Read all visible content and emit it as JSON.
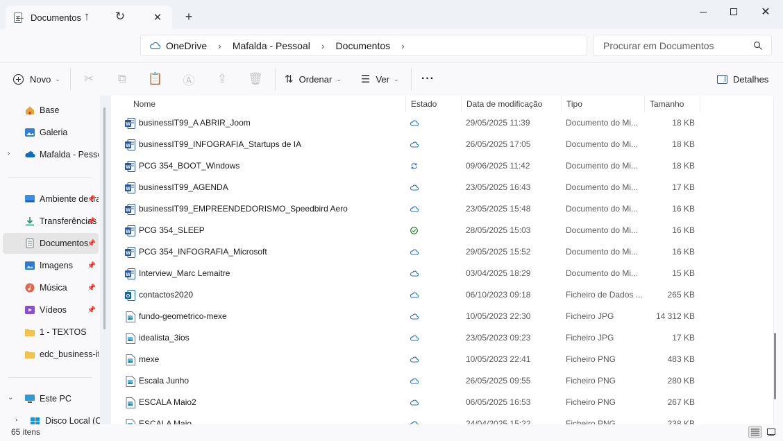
{
  "window": {
    "tab_title": "Documentos",
    "new_tab": "+",
    "close_tab": "✕"
  },
  "breadcrumb": {
    "items": [
      "OneDrive",
      "Mafalda - Pessoal",
      "Documentos"
    ]
  },
  "search": {
    "placeholder": "Procurar em Documentos"
  },
  "toolbar": {
    "new_label": "Novo",
    "sort_label": "Ordenar",
    "view_label": "Ver",
    "more_label": "···",
    "details_label": "Detalhes"
  },
  "sidebar": {
    "items": [
      {
        "label": "Base",
        "icon": "home-icon"
      },
      {
        "label": "Galeria",
        "icon": "gallery-icon"
      },
      {
        "label": "Mafalda - Pessoal",
        "icon": "onedrive-icon"
      },
      {
        "label": "Ambiente de trabalho",
        "icon": "desktop-icon"
      },
      {
        "label": "Transferências",
        "icon": "download-icon"
      },
      {
        "label": "Documentos",
        "icon": "documents-icon"
      },
      {
        "label": "Imagens",
        "icon": "pictures-icon"
      },
      {
        "label": "Música",
        "icon": "music-icon"
      },
      {
        "label": "Vídeos",
        "icon": "videos-icon"
      },
      {
        "label": "1 - TEXTOS",
        "icon": "folder-icon"
      },
      {
        "label": "edc_business-it-",
        "icon": "folder-icon"
      },
      {
        "label": "Este PC",
        "icon": "pc-icon"
      },
      {
        "label": "Disco Local (C:)",
        "icon": "drive-icon"
      }
    ]
  },
  "columns": {
    "name": "Nome",
    "state": "Estado",
    "date": "Data de modificação",
    "type": "Tipo",
    "size": "Tamanho"
  },
  "files": [
    {
      "name": "businessIT99_A ABRIR_Joom",
      "state": "cloud",
      "date": "29/05/2025 11:39",
      "type": "Documento do Mi...",
      "size": "18 KB",
      "icon": "word"
    },
    {
      "name": "businessIT99_INFOGRAFIA_Startups de IA",
      "state": "cloud",
      "date": "26/05/2025 17:05",
      "type": "Documento do Mi...",
      "size": "18 KB",
      "icon": "word"
    },
    {
      "name": "PCG 354_BOOT_Windows",
      "state": "sync",
      "date": "09/06/2025 11:42",
      "type": "Documento do Mi...",
      "size": "18 KB",
      "icon": "word"
    },
    {
      "name": "businessIT99_AGENDA",
      "state": "cloud",
      "date": "23/05/2025 16:43",
      "type": "Documento do Mi...",
      "size": "17 KB",
      "icon": "word"
    },
    {
      "name": "businessIT99_EMPREENDEDORISMO_Speedbird Aero",
      "state": "cloud",
      "date": "23/05/2025 15:48",
      "type": "Documento do Mi...",
      "size": "16 KB",
      "icon": "word"
    },
    {
      "name": "PCG 354_SLEEP",
      "state": "available",
      "date": "28/05/2025 15:03",
      "type": "Documento do Mi...",
      "size": "16 KB",
      "icon": "word"
    },
    {
      "name": "PCG 354_INFOGRAFIA_Microsoft",
      "state": "cloud",
      "date": "29/05/2025 15:52",
      "type": "Documento do Mi...",
      "size": "16 KB",
      "icon": "word"
    },
    {
      "name": "Interview_Marc Lemaitre",
      "state": "cloud",
      "date": "03/04/2025 18:29",
      "type": "Documento do Mi...",
      "size": "15 KB",
      "icon": "word"
    },
    {
      "name": "contactos2020",
      "state": "cloud",
      "date": "06/10/2023 09:18",
      "type": "Ficheiro de Dados ...",
      "size": "265 KB",
      "icon": "outlook"
    },
    {
      "name": "fundo-geometrico-mexe",
      "state": "cloud",
      "date": "10/05/2023 22:30",
      "type": "Ficheiro JPG",
      "size": "14 312 KB",
      "icon": "image"
    },
    {
      "name": "idealista_3ios",
      "state": "cloud",
      "date": "23/05/2023 09:23",
      "type": "Ficheiro JPG",
      "size": "17 KB",
      "icon": "image"
    },
    {
      "name": "mexe",
      "state": "cloud",
      "date": "10/05/2023 22:41",
      "type": "Ficheiro PNG",
      "size": "483 KB",
      "icon": "image"
    },
    {
      "name": "Escala Junho",
      "state": "cloud",
      "date": "26/05/2025 09:55",
      "type": "Ficheiro PNG",
      "size": "280 KB",
      "icon": "image"
    },
    {
      "name": "ESCALA Maio2",
      "state": "cloud",
      "date": "06/05/2025 16:53",
      "type": "Ficheiro PNG",
      "size": "267 KB",
      "icon": "image"
    },
    {
      "name": "ESCALA Maio",
      "state": "cloud",
      "date": "24/04/2025 15:22",
      "type": "Ficheiro PNG",
      "size": "238 KB",
      "icon": "image"
    }
  ],
  "status": {
    "item_count": "65 itens"
  },
  "colors": {
    "accent": "#0067c0",
    "word_blue": "#2b579a",
    "sync_ok": "#0f7b0f",
    "selected_bg": "#e5e5e5"
  }
}
